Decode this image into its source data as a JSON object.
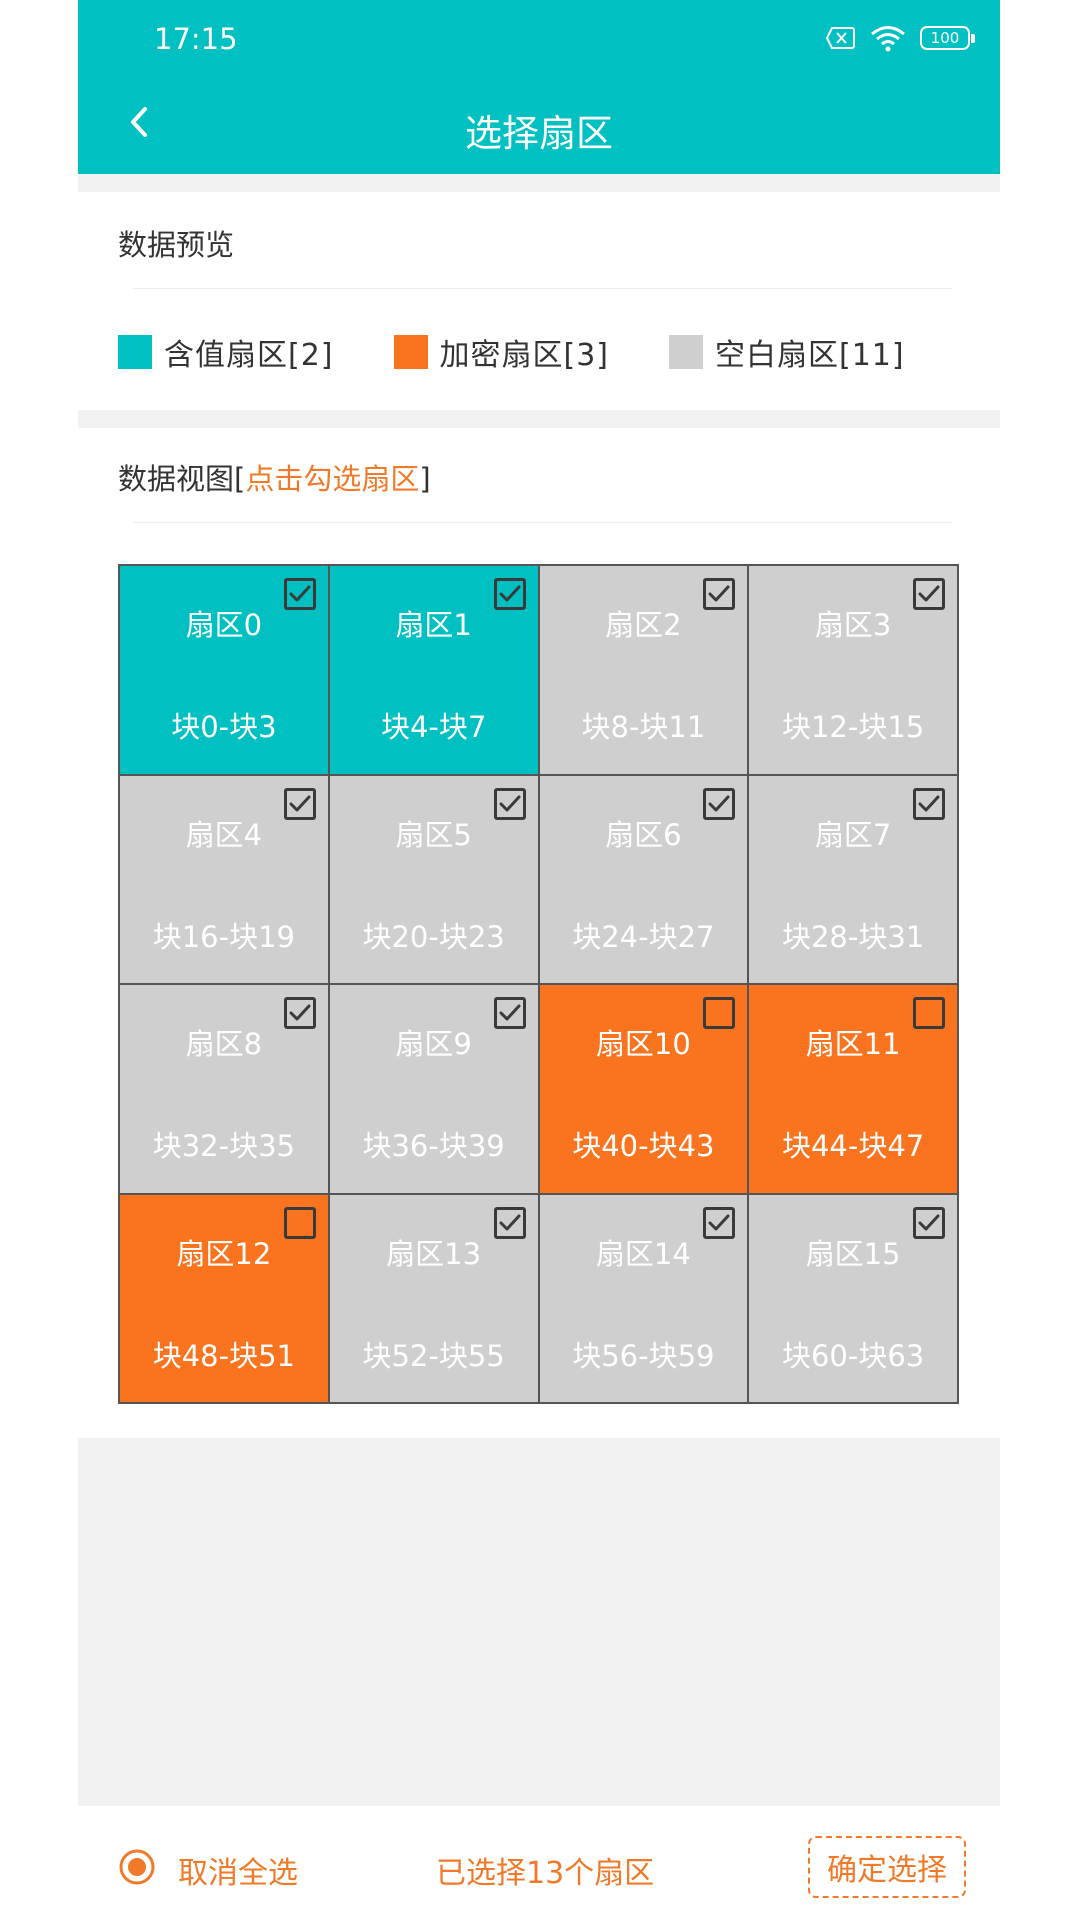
{
  "status_bar": {
    "time": "17:15",
    "battery": "100"
  },
  "header": {
    "title": "选择扇区"
  },
  "preview": {
    "title": "数据预览",
    "legend": [
      {
        "label": "含值扇区[2]",
        "color": "#00c0c2"
      },
      {
        "label": "加密扇区[3]",
        "color": "#fa7420"
      },
      {
        "label": "空白扇区[11]",
        "color": "#cfcfcf"
      }
    ]
  },
  "data_view": {
    "title_prefix": "数据视图[",
    "title_hint": "点击勾选扇区",
    "title_suffix": "]",
    "sectors": [
      {
        "name": "扇区0",
        "range": "块0-块3",
        "type": "value",
        "checked": true
      },
      {
        "name": "扇区1",
        "range": "块4-块7",
        "type": "value",
        "checked": true
      },
      {
        "name": "扇区2",
        "range": "块8-块11",
        "type": "empty",
        "checked": true
      },
      {
        "name": "扇区3",
        "range": "块12-块15",
        "type": "empty",
        "checked": true
      },
      {
        "name": "扇区4",
        "range": "块16-块19",
        "type": "empty",
        "checked": true
      },
      {
        "name": "扇区5",
        "range": "块20-块23",
        "type": "empty",
        "checked": true
      },
      {
        "name": "扇区6",
        "range": "块24-块27",
        "type": "empty",
        "checked": true
      },
      {
        "name": "扇区7",
        "range": "块28-块31",
        "type": "empty",
        "checked": true
      },
      {
        "name": "扇区8",
        "range": "块32-块35",
        "type": "empty",
        "checked": true
      },
      {
        "name": "扇区9",
        "range": "块36-块39",
        "type": "empty",
        "checked": true
      },
      {
        "name": "扇区10",
        "range": "块40-块43",
        "type": "encrypted",
        "checked": false
      },
      {
        "name": "扇区11",
        "range": "块44-块47",
        "type": "encrypted",
        "checked": false
      },
      {
        "name": "扇区12",
        "range": "块48-块51",
        "type": "encrypted",
        "checked": false
      },
      {
        "name": "扇区13",
        "range": "块52-块55",
        "type": "empty",
        "checked": true
      },
      {
        "name": "扇区14",
        "range": "块56-块59",
        "type": "empty",
        "checked": true
      },
      {
        "name": "扇区15",
        "range": "块60-块63",
        "type": "empty",
        "checked": true
      }
    ]
  },
  "colors": {
    "value": "#00c0c2",
    "encrypted": "#fa7420",
    "empty": "#cfcfcf",
    "accent": "#f07a2a"
  },
  "footer": {
    "cancel_all_label": "取消全选",
    "selected_text": "已选择13个扇区",
    "confirm_label": "确定选择"
  }
}
